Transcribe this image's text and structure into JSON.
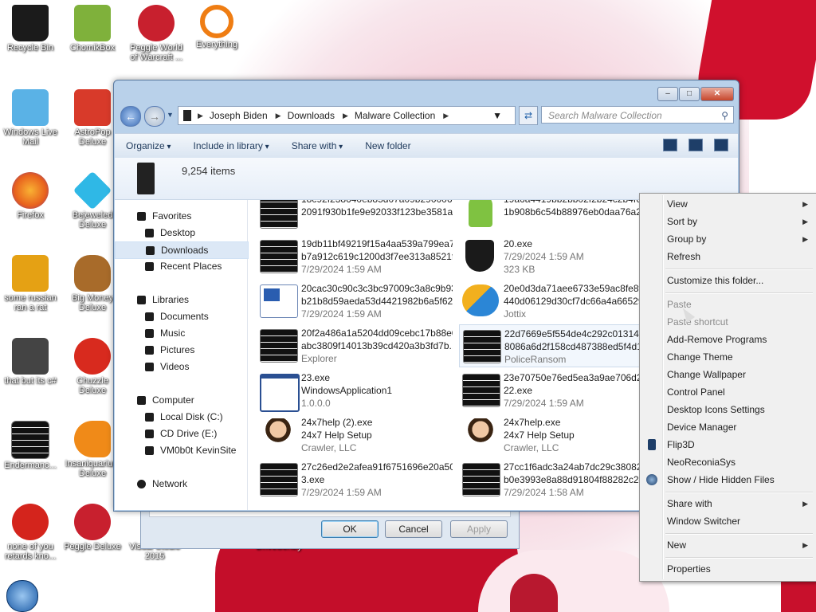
{
  "desktop": {
    "icons": [
      {
        "label": "Recycle Bin",
        "icon": "recycle-bin-icon",
        "color": "#1b1b1b"
      },
      {
        "label": "ChomikBox",
        "icon": "chomikbox-icon",
        "color": "#7fb13b"
      },
      {
        "label": "Peggle World of Warcraft ...",
        "icon": "peggle-icon",
        "color": "#c8202e"
      },
      {
        "label": "Everything",
        "icon": "magnifier-icon",
        "color": "#ef7d13"
      },
      {
        "label": "Windows Live Mail",
        "icon": "mail-icon",
        "color": "#5ab2e6"
      },
      {
        "label": "AstroPop Deluxe",
        "icon": "astropop-icon",
        "color": "#d83a2a"
      },
      {
        "label": "Firefox",
        "icon": "firefox-icon",
        "color": "#e8611d"
      },
      {
        "label": "Bejeweled Deluxe",
        "icon": "gem-icon",
        "color": "#2fb8e6"
      },
      {
        "label": "some russian ran a rat",
        "icon": "de-icon",
        "color": "#e5a114"
      },
      {
        "label": "Big Money Deluxe",
        "icon": "money-bag-icon",
        "color": "#a86b2a"
      },
      {
        "label": "that but its c#",
        "icon": "windows-stack-icon",
        "color": "#444444"
      },
      {
        "label": "Chuzzle Deluxe",
        "icon": "chuzzle-icon",
        "color": "#d82a1e"
      },
      {
        "label": "Endermanc...",
        "icon": "console-icon",
        "color": "#111111"
      },
      {
        "label": "Insaniquarium Deluxe",
        "icon": "fish-icon",
        "color": "#f08a18"
      },
      {
        "label": "none of you retards kno...",
        "icon": "red-bird-icon",
        "color": "#d4241c"
      },
      {
        "label": "Peggle Deluxe",
        "icon": "peggle-deluxe-icon",
        "color": "#c8202e"
      },
      {
        "label": "Visual Studio 2015",
        "icon": "visual-studio-icon",
        "color": "#6a3fa0"
      },
      {
        "label": "DriveSentry",
        "icon": "drivesentry-icon",
        "color": "#3a6ea5"
      }
    ]
  },
  "explorer": {
    "breadcrumb": [
      "Joseph Biden",
      "Downloads",
      "Malware Collection"
    ],
    "search_placeholder": "Search Malware Collection",
    "toolbar": {
      "organize": "Organize",
      "include": "Include in library",
      "share": "Share with",
      "new_folder": "New folder"
    },
    "item_count": "9,254 items",
    "nav": {
      "favorites": "Favorites",
      "desktop": "Desktop",
      "downloads": "Downloads",
      "recent": "Recent Places",
      "libraries": "Libraries",
      "documents": "Documents",
      "music": "Music",
      "pictures": "Pictures",
      "videos": "Videos",
      "computer": "Computer",
      "local_disk": "Local Disk (C:)",
      "cd_drive": "CD Drive (E:)",
      "vm": "VM0b0t KevinSite",
      "network": "Network"
    },
    "files": [
      {
        "l1": "18c92f238640eb85d07a09b29000621",
        "l2": "2091f930b1fe9e92033f123be3581a...",
        "l3": "",
        "icon": "console-file-icon"
      },
      {
        "l1": "19a6a4419bb2bb02f2b24c2b4f60",
        "l2": "1b908b6c54b88976eb0daa76a29",
        "l3": "",
        "icon": "user-setup-icon"
      },
      {
        "l1": "19db11bf49219f15a4aa539a799ea7b",
        "l2": "b7a912c619c1200d3f7ee313a8521f...",
        "l3": "7/29/2024 1:59 AM",
        "icon": "console-file-icon"
      },
      {
        "l1": "20.exe",
        "l2": "7/29/2024 1:59 AM",
        "l3": "323 KB",
        "icon": "shield-file-icon"
      },
      {
        "l1": "20cac30c90c3c3bc97009c3a8c9b93",
        "l2": "b21b8d59aeda53d4421982b6a5f62...",
        "l3": "7/29/2024 1:59 AM",
        "icon": "word-doc-icon"
      },
      {
        "l1": "20e0d3da71aee6733e59ac8fe8fd",
        "l2": "440d06129d30cf7dc66a4a665298",
        "l3": "Jottix",
        "icon": "jottix-icon"
      },
      {
        "l1": "20f2a486a1a5204dd09cebc17b88e0",
        "l2": "abc3809f14013b39cd420a3b3fd7b...",
        "l3": "Explorer",
        "icon": "console-file-icon"
      },
      {
        "l1": "22d7669e5f554de4c292c0131498",
        "l2": "8086a6d2f158cd487388ed5f4d11",
        "l3": "PoliceRansom",
        "icon": "console-file-icon"
      },
      {
        "l1": "23.exe",
        "l2": "WindowsApplication1",
        "l3": "1.0.0.0",
        "icon": "window-app-icon"
      },
      {
        "l1": "23e70750e76ed5ea3a9ae706d234",
        "l2": "22.exe",
        "l3": "7/29/2024 1:59 AM",
        "icon": "console-file-icon"
      },
      {
        "l1": "24x7help (2).exe",
        "l2": "24x7 Help Setup",
        "l3": "Crawler, LLC",
        "icon": "support-agent-icon"
      },
      {
        "l1": "24x7help.exe",
        "l2": "24x7 Help Setup",
        "l3": "Crawler, LLC",
        "icon": "support-agent-icon"
      },
      {
        "l1": "27c26ed2e2afea91f6751696e20a506",
        "l2": "3.exe",
        "l3": "7/29/2024 1:59 AM",
        "icon": "console-file-icon"
      },
      {
        "l1": "27cc1f6adc3a24ab7dc29c38082e",
        "l2": "b0e3993e8a88d91804f88282c240",
        "l3": "7/29/2024 1:58 AM",
        "icon": "console-file-icon"
      }
    ]
  },
  "dialog": {
    "ok": "OK",
    "cancel": "Cancel",
    "apply": "Apply"
  },
  "context_menu": {
    "view": "View",
    "sort_by": "Sort by",
    "group_by": "Group by",
    "refresh": "Refresh",
    "customize": "Customize this folder...",
    "paste": "Paste",
    "paste_shortcut": "Paste shortcut",
    "add_remove": "Add-Remove Programs",
    "change_theme": "Change Theme",
    "change_wallpaper": "Change Wallpaper",
    "control_panel": "Control Panel",
    "desktop_icons": "Desktop Icons Settings",
    "device_manager": "Device Manager",
    "flip3d": "Flip3D",
    "neoreconia": "NeoReconiaSys",
    "show_hide": "Show / Hide Hidden Files",
    "share_with": "Share with",
    "window_switcher": "Window Switcher",
    "new": "New",
    "properties": "Properties"
  }
}
